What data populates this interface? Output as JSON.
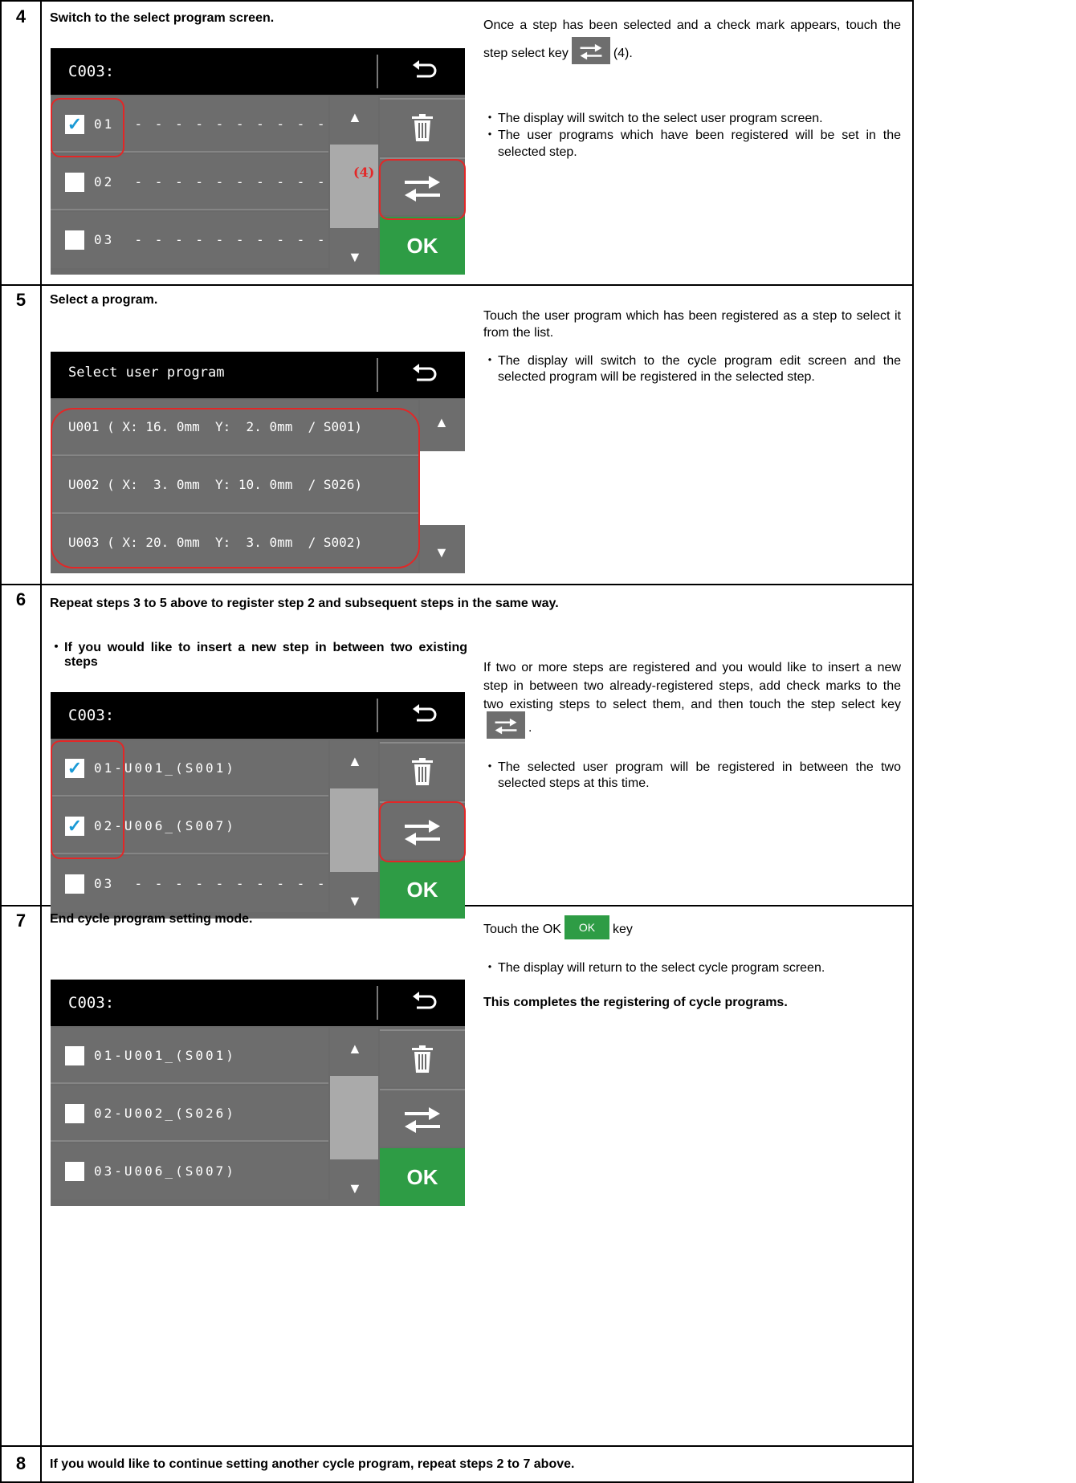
{
  "steps": {
    "s4": {
      "num": "4",
      "title": "Switch to the select program screen.",
      "p1a": "Once a step has been selected and a check mark appears, touch the step select key",
      "p1b": "(4).",
      "bullets": [
        "The display will switch to the select user program screen.",
        "The user programs which have been registered will be set in the selected step."
      ]
    },
    "s5": {
      "num": "5",
      "title": "Select a program.",
      "p1": "Touch the user program which has been registered as a step to select it from the list.",
      "bullets": [
        "The display will switch to the cycle program edit screen and the selected program will be registered in the selected step."
      ]
    },
    "s6": {
      "num": "6",
      "title": "Repeat steps 3 to 5 above to register step 2 and subsequent steps in the same way.",
      "sub": "If you would like to insert a new step in between two existing steps",
      "p1a": "If two or more steps are registered and you would like to insert a new step in between two already-registered steps, add check marks to the two existing steps to select them, and then touch the step select key",
      "p1b": ".",
      "bullets": [
        "The selected user program will be registered in between the two selected steps at this time."
      ]
    },
    "s7": {
      "num": "7",
      "title": "End cycle program setting mode.",
      "p1a": "Touch the OK",
      "p1b": "key",
      "bullets": [
        "The display will return to the select cycle program screen."
      ],
      "final": "This completes the registering of cycle programs."
    },
    "s8": {
      "num": "8",
      "title": "If you would like to continue setting another cycle program, repeat steps 2 to 7 above."
    }
  },
  "screens": {
    "cycle_title": "C003:",
    "ok_label": "OK",
    "key_ok": "OK",
    "callout": "(4)",
    "s4_rows": [
      {
        "label": "01  - - - - - - - - - - -",
        "checked": true
      },
      {
        "label": "02  - - - - - - - - - - -",
        "checked": false
      },
      {
        "label": "03  - - - - - - - - - - -",
        "checked": false
      }
    ],
    "s6_rows": [
      {
        "label": "01-U001_(S001)",
        "checked": true
      },
      {
        "label": "02-U006_(S007)",
        "checked": true
      },
      {
        "label": "03  - - - - - - - - - - -",
        "checked": false
      }
    ],
    "s7_rows": [
      {
        "label": "01-U001_(S001)",
        "checked": false
      },
      {
        "label": "02-U002_(S026)",
        "checked": false
      },
      {
        "label": "03-U006_(S007)",
        "checked": false
      }
    ],
    "select_title": "Select user program",
    "programs": [
      "U001 ( X: 16. 0mm  Y:  2. 0mm  / S001)",
      "U002 ( X:  3. 0mm  Y: 10. 0mm  / S026)",
      "U003 ( X: 20. 0mm  Y:  3. 0mm  / S002)"
    ]
  },
  "icons": {
    "back": "back-arrow-icon",
    "trash": "trash-icon",
    "swap": "swap-arrows-icon",
    "up": "triangle-up-icon",
    "down": "triangle-down-icon"
  },
  "colors": {
    "ok_green": "#2e9c45",
    "highlight_red": "#e32727",
    "check_blue": "#1a9ad6"
  },
  "checkmark": "✓",
  "bullet": "・"
}
